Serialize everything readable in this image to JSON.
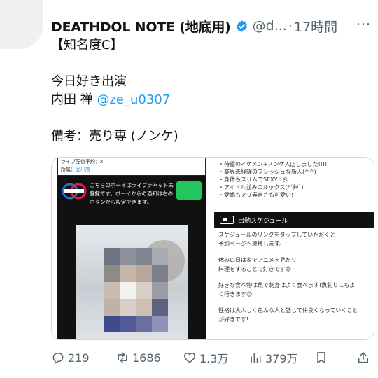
{
  "tweet": {
    "author_name": "DEATHDOL NOTE (地底用)",
    "handle": "@d...",
    "separator": "·",
    "time": "17時間",
    "more": "···",
    "lines": {
      "rank": "【知名度C】",
      "show_label": "今日好き出演",
      "person_name": "内田 禅",
      "person_mention": "@ze_u0307",
      "note": "備考：売り専 (ノンケ)"
    }
  },
  "media": {
    "left": {
      "live_schedule": "ライブ配信予約：x",
      "shop_label": "所属：",
      "shop_link": "品川店",
      "notice": "こちらのボーイはライブチャット未登録です。ボーイからの通知は右のボタンから設定できます。"
    },
    "right": {
      "bullets": [
        "・待望のイケメン+ノンケ入店しました!!!!",
        "・業界未経験のフレッシュな新人(^^)",
        "・身体もスリムでSEXY☆彡",
        "・アイドル並みのルックス(*´艸`)",
        "・愛嬌もアリ素直さも可愛い!"
      ],
      "schedule_title": "出勤スケジュール",
      "schedule_desc": [
        "スケジュールのリンクをタップしていただくと",
        "予約ページへ遷移します。"
      ],
      "para1": [
        "休みの日は家でアニメを見たり",
        "料理をすることで好きです😊"
      ],
      "para2": [
        "好きな食べ物は魚で刺身はよく食べます!魚釣りにもよ",
        "く行きます😊"
      ],
      "para3": [
        "性格は大人しく色んな人と話して仲良くなっていくこと",
        "が好きです!"
      ]
    }
  },
  "actions": {
    "replies": "219",
    "reposts": "1686",
    "likes": "1.3万",
    "views": "379万"
  },
  "icons": [
    "verified-badge-icon",
    "reply-icon",
    "repost-icon",
    "like-icon",
    "views-icon",
    "bookmark-icon",
    "share-icon"
  ],
  "colors": {
    "link": "#1d9bf0",
    "muted": "#536471",
    "text": "#0f1419"
  }
}
